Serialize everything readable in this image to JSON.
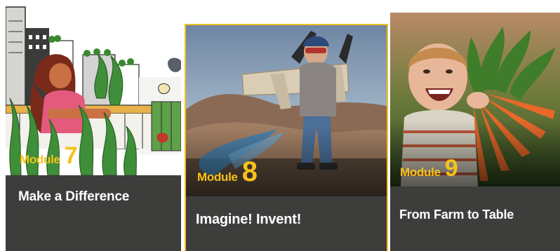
{
  "cards": [
    {
      "module_word": "Module",
      "module_number": "7",
      "title": "Make a Difference"
    },
    {
      "module_word": "Module",
      "module_number": "8",
      "title": "Imagine! Invent!"
    },
    {
      "module_word": "Module",
      "module_number": "9",
      "title": "From Farm to Table"
    }
  ],
  "colors": {
    "accent": "#f6c21b",
    "card_bg": "#3d3d3c",
    "highlight_border": "#f3be1f"
  }
}
